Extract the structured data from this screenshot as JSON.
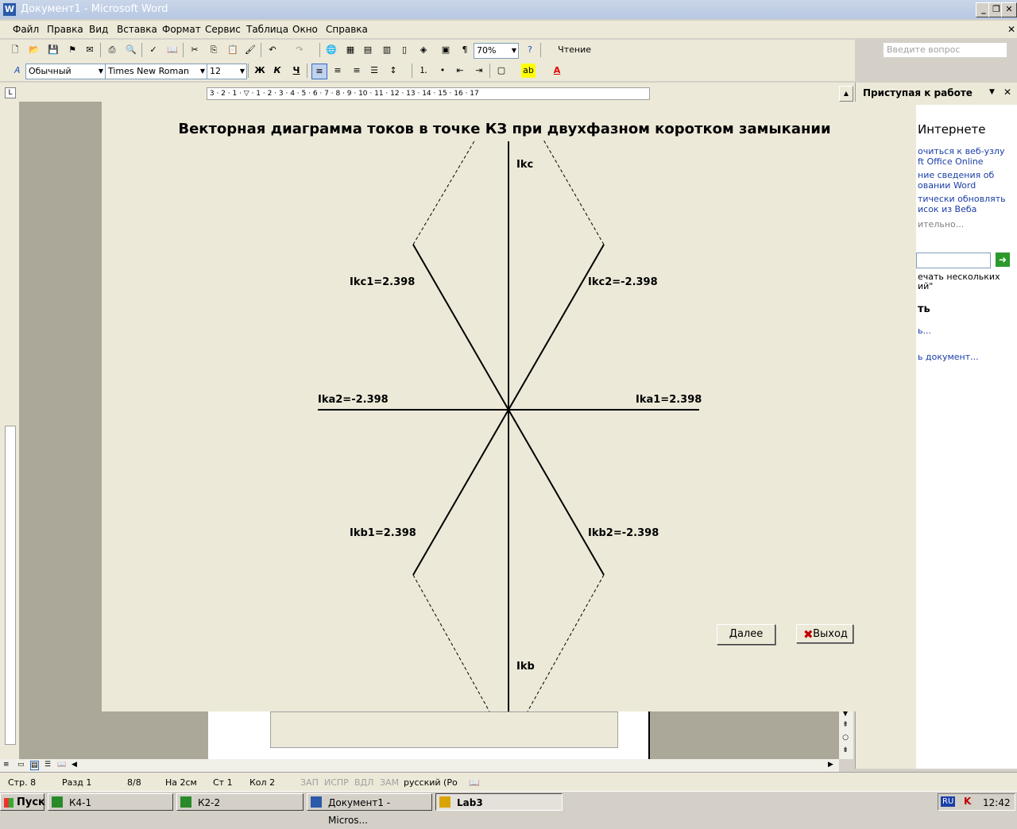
{
  "window": {
    "title": "Документ1 - Microsoft Word"
  },
  "menu": {
    "items": [
      "Файл",
      "Правка",
      "Вид",
      "Вставка",
      "Формат",
      "Сервис",
      "Таблица",
      "Окно",
      "Справка"
    ],
    "ask_placeholder": "Введите вопрос"
  },
  "toolbar": {
    "zoom": "70%",
    "reading_label": "Чтение",
    "style": "Обычный",
    "font": "Times New Roman",
    "size": "12",
    "bold": "Ж",
    "italic": "К",
    "underline": "Ч"
  },
  "task_pane": {
    "title": "Приступая к работе",
    "section": "Интернете",
    "links": [
      "очиться к веб-узлу",
      "ft Office Online",
      "ние сведения об",
      "овании Word",
      "тически обновлять",
      "исок из Веба",
      "ительно...",
      "ечать нескольких",
      "ий\"",
      "ь...",
      "ь документ..."
    ],
    "heading2": "ть"
  },
  "dialog": {
    "title": "Векторная диаграмма токов в точке КЗ при двухфазном коротком замыкании",
    "labels": {
      "ikc": "Ikc",
      "ikb": "Ikb",
      "ikc1": "Ikc1=2.398",
      "ikc2": "Ikc2=-2.398",
      "ika2": "Ika2=-2.398",
      "ika1": "Ika1=2.398",
      "ikb1": "Ikb1=2.398",
      "ikb2": "Ikb2=-2.398"
    },
    "next_button": "Далее",
    "exit_button": "Выход"
  },
  "status": {
    "page": "Стр. 8",
    "section": "Разд 1",
    "pages": "8/8",
    "at": "На 2см",
    "line": "Ст 1",
    "col": "Кол 2",
    "rec": "ЗАП",
    "trk": "ИСПР",
    "ext": "ВДЛ",
    "ovr": "ЗАМ",
    "lang": "русский (Ро"
  },
  "taskbar": {
    "start": "Пуск",
    "buttons": [
      "К4-1",
      "К2-2",
      "Документ1 - Micros...",
      "Lab3"
    ],
    "lang": "RU",
    "time": "12:42"
  }
}
